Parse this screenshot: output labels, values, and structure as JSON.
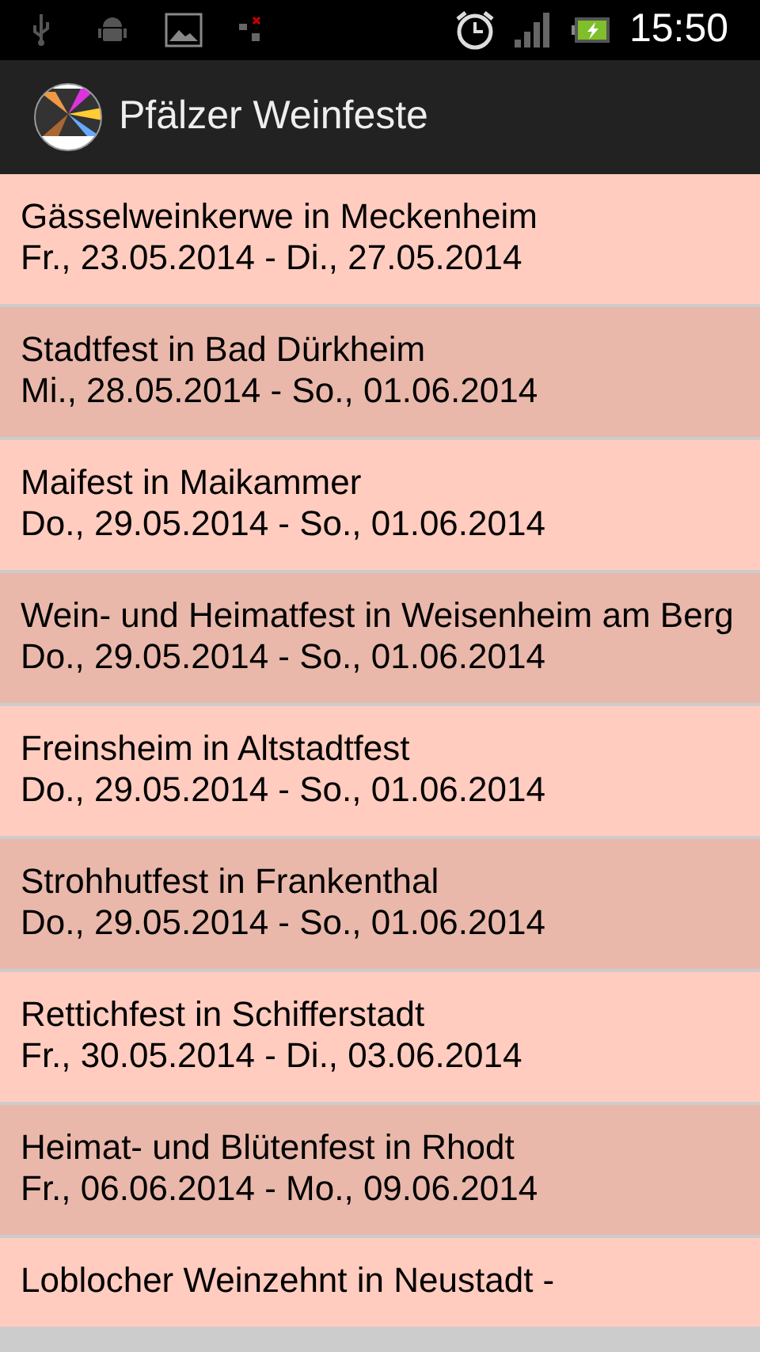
{
  "status_bar": {
    "time": "15:50"
  },
  "app_bar": {
    "title": "Pfälzer Weinfeste"
  },
  "events": [
    {
      "name": "Gässelweinkerwe in Meckenheim",
      "dates": "Fr., 23.05.2014 - Di., 27.05.2014",
      "color": "#ffccbf"
    },
    {
      "name": "Stadtfest in Bad Dürkheim",
      "dates": "Mi., 28.05.2014 - So., 01.06.2014",
      "color": "#e9b8aa"
    },
    {
      "name": "Maifest in Maikammer",
      "dates": "Do., 29.05.2014 - So., 01.06.2014",
      "color": "#ffccbf"
    },
    {
      "name": "Wein- und Heimatfest in Weisenheim am Berg",
      "dates": "Do., 29.05.2014 - So., 01.06.2014",
      "color": "#e9b8aa"
    },
    {
      "name": "Freinsheim in Altstadtfest",
      "dates": "Do., 29.05.2014 - So., 01.06.2014",
      "color": "#ffccbf"
    },
    {
      "name": "Strohhutfest in Frankenthal",
      "dates": "Do., 29.05.2014 - So., 01.06.2014",
      "color": "#e9b8aa"
    },
    {
      "name": "Rettichfest in Schifferstadt",
      "dates": "Fr., 30.05.2014 - Di., 03.06.2014",
      "color": "#ffccbf"
    },
    {
      "name": "Heimat- und Blütenfest in Rhodt",
      "dates": "Fr., 06.06.2014 - Mo., 09.06.2014",
      "color": "#e9b8aa"
    },
    {
      "name": "Loblocher Weinzehnt in Neustadt -",
      "color": "#ffccbf"
    }
  ]
}
